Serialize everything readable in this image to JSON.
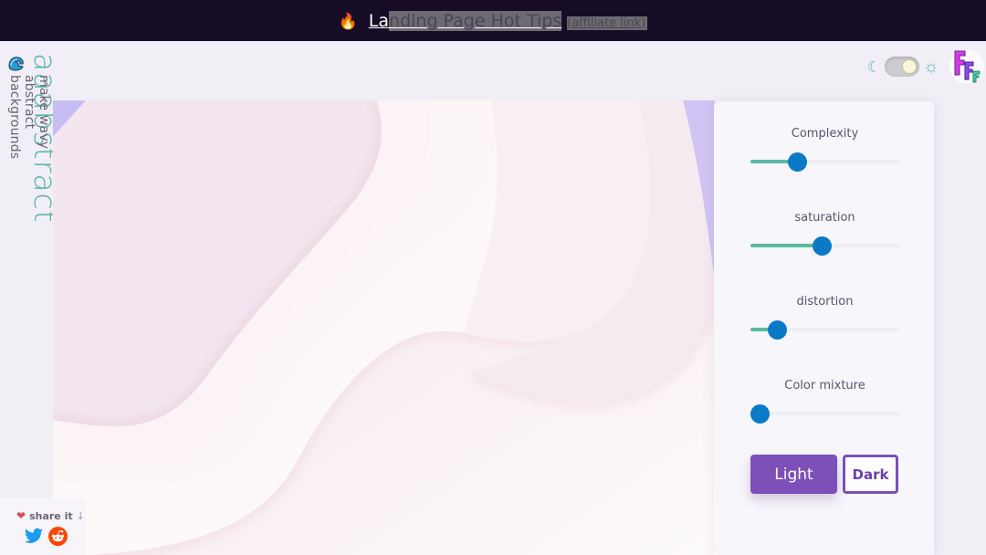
{
  "promo": {
    "emoji": "🔥",
    "title_plain": "La",
    "title_highlight": "nding Page Hot Tips",
    "subtitle": "(affiliate link)"
  },
  "brand": {
    "name": "aaabstract",
    "tagline": "make wavy abstract backgrounds",
    "logo_icon": "wave-icon"
  },
  "theme_toggle": {
    "left_icon": "☾",
    "right_icon": "☼",
    "state": "light"
  },
  "colors": {
    "accent_teal": "#5bb8a4",
    "slider_thumb": "#0a7ac6",
    "button_purple": "#7d4fb8",
    "promo_bg": "#160c26"
  },
  "controls": {
    "sliders": [
      {
        "label": "Complexity",
        "value": 0.31
      },
      {
        "label": "saturation",
        "value": 0.48
      },
      {
        "label": "distortion",
        "value": 0.18
      },
      {
        "label": "Color mixture",
        "value": 0.06
      }
    ],
    "light_button": "Light",
    "dark_button": "Dark"
  },
  "share": {
    "label": "share it",
    "arrow": "↓",
    "heart": "❤"
  }
}
